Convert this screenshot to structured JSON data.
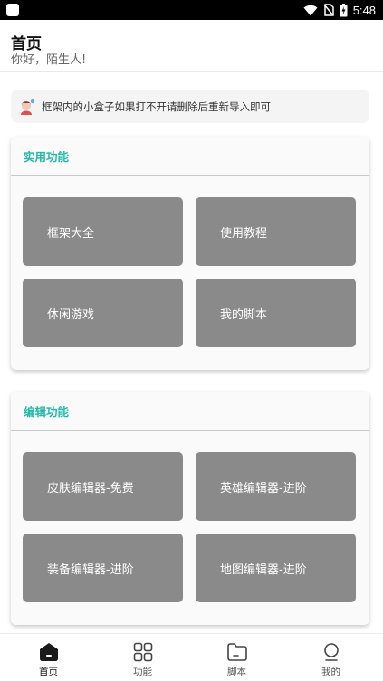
{
  "status_bar": {
    "time": "5:48",
    "icons": [
      "wifi-icon",
      "no-sim-icon",
      "battery-charging-icon"
    ]
  },
  "header": {
    "title": "首页",
    "subtitle": "你好，陌生人!"
  },
  "notice": {
    "icon": "avatar-sticker-icon",
    "text": "框架内的小盒子如果打不开请删除后重新导入即可"
  },
  "sections": [
    {
      "title": "实用功能",
      "items": [
        {
          "label": "框架大全"
        },
        {
          "label": "使用教程"
        },
        {
          "label": "休闲游戏"
        },
        {
          "label": "我的脚本"
        }
      ]
    },
    {
      "title": "编辑功能",
      "items": [
        {
          "label": "皮肤编辑器-免费"
        },
        {
          "label": "英雄编辑器-进阶"
        },
        {
          "label": "装备编辑器-进阶"
        },
        {
          "label": "地图编辑器-进阶"
        }
      ]
    }
  ],
  "tabbar": {
    "tabs": [
      {
        "label": "首页",
        "icon": "home-icon",
        "active": true
      },
      {
        "label": "功能",
        "icon": "grid-icon",
        "active": false
      },
      {
        "label": "脚本",
        "icon": "folder-icon",
        "active": false
      },
      {
        "label": "我的",
        "icon": "profile-icon",
        "active": false
      }
    ]
  },
  "colors": {
    "accent": "#1fb9a6",
    "tile": "#8b8a8a",
    "card": "#fafafa",
    "notice_bg": "#f4f4f4"
  }
}
